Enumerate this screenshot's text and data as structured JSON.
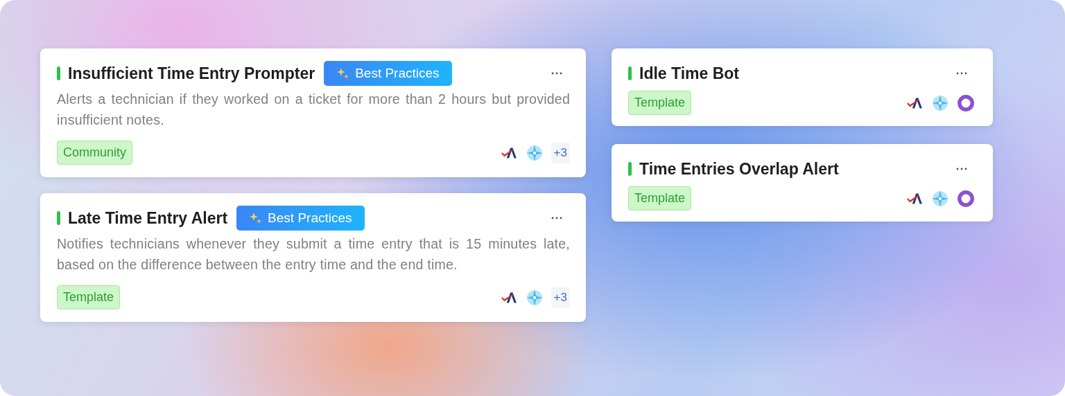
{
  "columns": [
    {
      "cards": [
        {
          "title": "Insufficient Time Entry Prompter",
          "badge": "Best Practices",
          "description": "Alerts a technician if they worked on a ticket for more than 2 hours but provided insufficient notes.",
          "tag": "Community",
          "integrations": [
            {
              "kind": "a-check"
            },
            {
              "kind": "compass"
            }
          ],
          "more": "+3"
        },
        {
          "title": "Late Time Entry Alert",
          "badge": "Best Practices",
          "description": "Notifies technicians whenever they submit a time entry that is 15 minutes late, based on the difference between the entry time and the end time.",
          "tag": "Template",
          "integrations": [
            {
              "kind": "a-check"
            },
            {
              "kind": "compass"
            }
          ],
          "more": "+3"
        }
      ]
    },
    {
      "cards": [
        {
          "title": "Idle Time Bot",
          "tag": "Template",
          "integrations": [
            {
              "kind": "a-check"
            },
            {
              "kind": "compass"
            },
            {
              "kind": "ring"
            }
          ]
        },
        {
          "title": "Time Entries Overlap Alert",
          "tag": "Template",
          "integrations": [
            {
              "kind": "a-check"
            },
            {
              "kind": "compass"
            },
            {
              "kind": "ring"
            }
          ]
        }
      ]
    }
  ]
}
